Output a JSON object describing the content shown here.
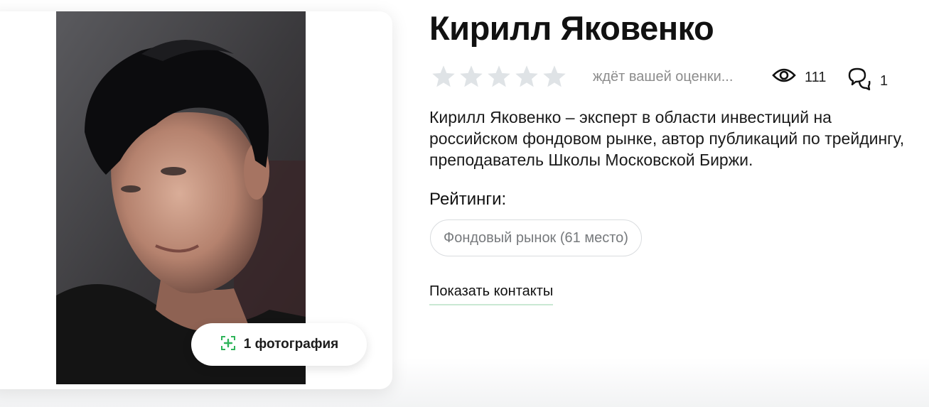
{
  "profile": {
    "name": "Кирилл Яковенко",
    "photo_badge_label": "1 фотография",
    "rating_hint": "ждёт вашей оценки...",
    "stars_total": 5,
    "stars_filled": 0,
    "views_count": "111",
    "comments_count": "1",
    "bio": "Кирилл Яковенко – эксперт в области инвестиций на российском фондовом рынке, автор публикаций по трейдингу, преподаватель Школы Московской Биржи.",
    "ratings_title": "Рейтинги:",
    "ratings": [
      {
        "label": "Фондовый рынок (61 место)"
      }
    ],
    "show_contacts_label": "Показать контакты"
  },
  "icons": {
    "star": "star-icon",
    "views": "eye-icon",
    "comments": "chat-bubbles-icon",
    "add_photo": "add-photo-icon"
  },
  "colors": {
    "accent_green": "#2fb45a",
    "star_empty": "#dfe3e6",
    "muted_text": "#8c8c8c"
  }
}
